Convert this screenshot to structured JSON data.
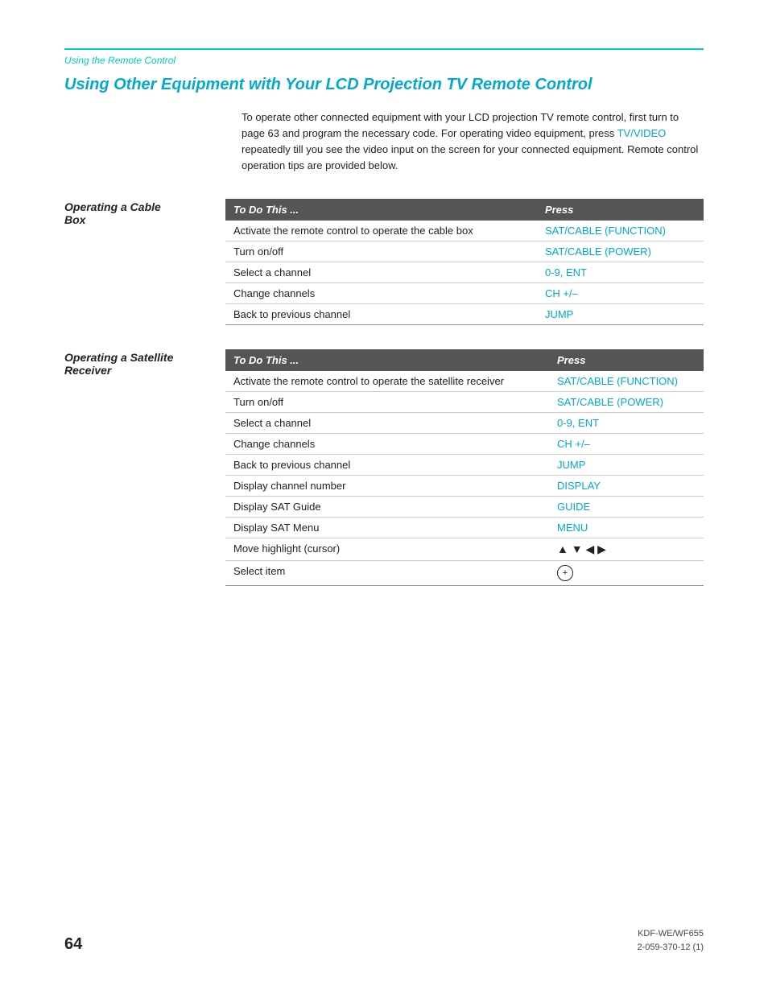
{
  "top_rule": true,
  "section_label": "Using the Remote Control",
  "main_title": "Using Other Equipment with Your LCD Projection TV Remote Control",
  "intro": {
    "text_before": "To operate other connected equipment with your LCD projection TV remote control, first turn to page 63 and program the necessary code. For operating video equipment, press ",
    "cyan_word": "TV/VIDEO",
    "text_after": " repeatedly till you see the video input on the screen for your connected equipment. Remote control operation tips are provided below."
  },
  "cable_box": {
    "heading_line1": "Operating a Cable",
    "heading_line2": "Box",
    "table_header_col1": "To Do This ...",
    "table_header_col2": "Press",
    "rows": [
      {
        "todo": "Activate the remote control to operate the cable box",
        "press": "SAT/CABLE (FUNCTION)",
        "press_cyan": true
      },
      {
        "todo": "Turn on/off",
        "press": "SAT/CABLE (POWER)",
        "press_cyan": true
      },
      {
        "todo": "Select a channel",
        "press": "0-9, ENT",
        "press_cyan": true
      },
      {
        "todo": "Change channels",
        "press": "CH +/–",
        "press_cyan": true
      },
      {
        "todo": "Back to previous channel",
        "press": "JUMP",
        "press_cyan": true
      }
    ]
  },
  "satellite_receiver": {
    "heading_line1": "Operating a Satellite",
    "heading_line2": "Receiver",
    "table_header_col1": "To Do This ...",
    "table_header_col2": "Press",
    "rows": [
      {
        "todo": "Activate the remote control to operate the satellite receiver",
        "press": "SAT/CABLE (FUNCTION)",
        "press_cyan": true
      },
      {
        "todo": "Turn on/off",
        "press": "SAT/CABLE (POWER)",
        "press_cyan": true
      },
      {
        "todo": "Select a channel",
        "press": "0-9, ENT",
        "press_cyan": true
      },
      {
        "todo": "Change channels",
        "press": "CH +/–",
        "press_cyan": true
      },
      {
        "todo": "Back to previous channel",
        "press": "JUMP",
        "press_cyan": true
      },
      {
        "todo": "Display channel number",
        "press": "DISPLAY",
        "press_cyan": true
      },
      {
        "todo": "Display SAT Guide",
        "press": "GUIDE",
        "press_cyan": true
      },
      {
        "todo": "Display SAT Menu",
        "press": "MENU",
        "press_cyan": true
      },
      {
        "todo": "Move highlight (cursor)",
        "press": "arrows",
        "press_cyan": false,
        "press_special": "arrows"
      },
      {
        "todo": "Select item",
        "press": "circle_plus",
        "press_cyan": false,
        "press_special": "circle_plus"
      }
    ]
  },
  "footer": {
    "page_number": "64",
    "model_line1": "KDF-WE/WF655",
    "model_line2": "2-059-370-12 (1)"
  }
}
